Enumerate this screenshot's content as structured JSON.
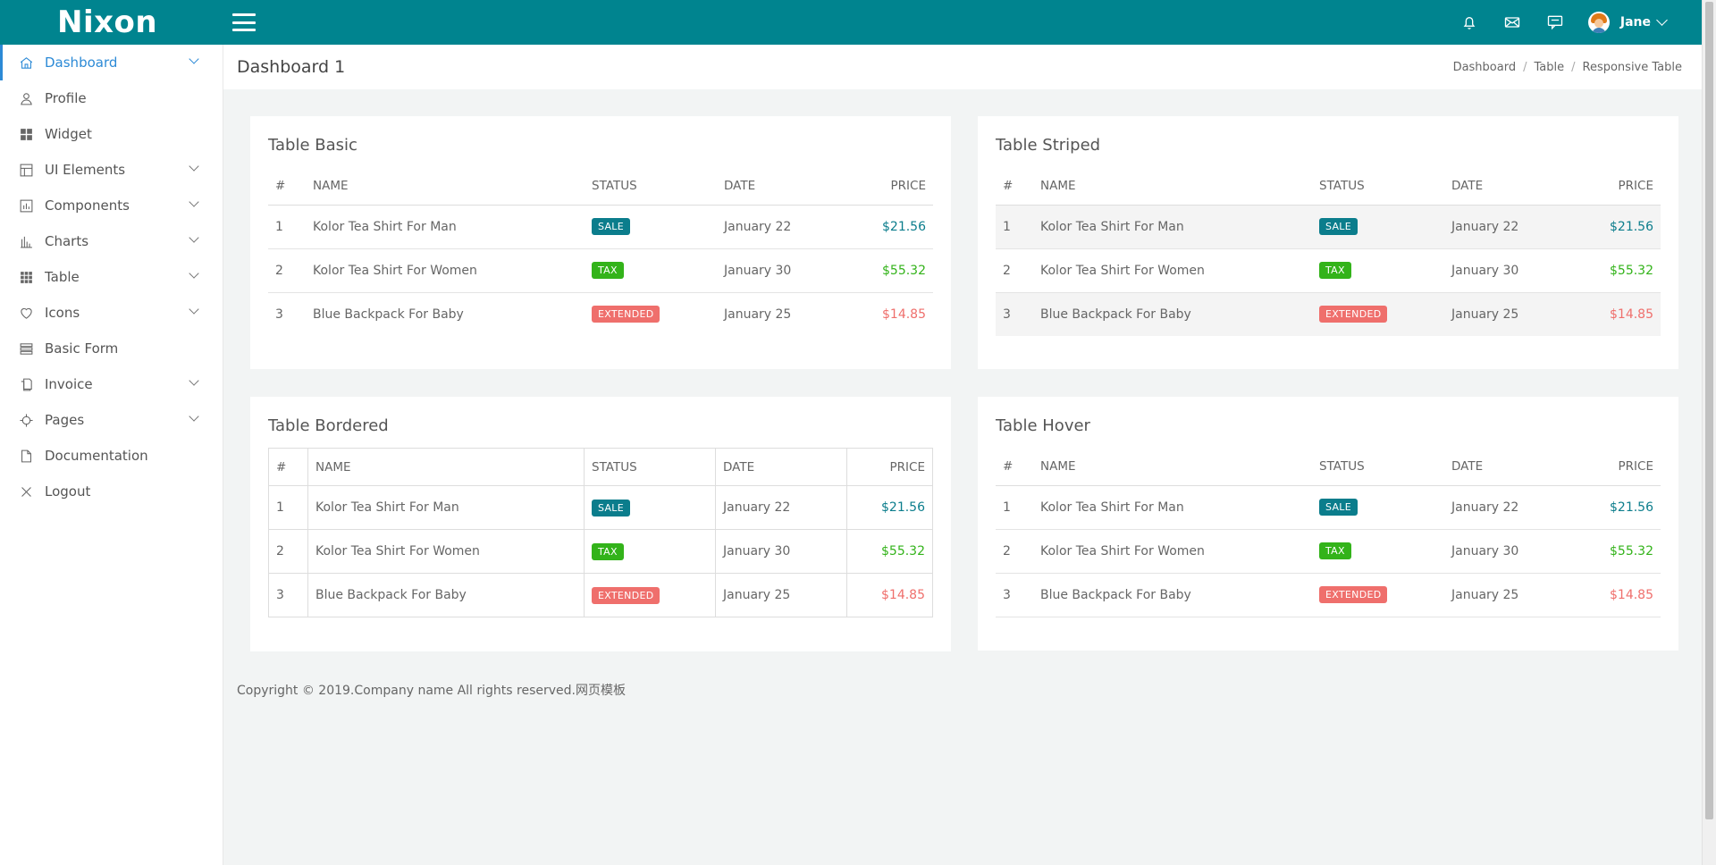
{
  "brand": {
    "name": "Nixon"
  },
  "topbar": {
    "user_name": "Jane",
    "icons": [
      "menu-icon",
      "bell-icon",
      "mail-icon",
      "chat-icon"
    ]
  },
  "sidebar": {
    "items": [
      {
        "label": "Dashboard",
        "icon": "home-icon",
        "expandable": true,
        "active": true
      },
      {
        "label": "Profile",
        "icon": "user-icon",
        "expandable": false
      },
      {
        "label": "Widget",
        "icon": "grid-icon",
        "expandable": false
      },
      {
        "label": "UI Elements",
        "icon": "layout-icon",
        "expandable": true
      },
      {
        "label": "Components",
        "icon": "components-icon",
        "expandable": true
      },
      {
        "label": "Charts",
        "icon": "bar-chart-icon",
        "expandable": true
      },
      {
        "label": "Table",
        "icon": "table-icon",
        "expandable": true
      },
      {
        "label": "Icons",
        "icon": "heart-icon",
        "expandable": true
      },
      {
        "label": "Basic Form",
        "icon": "form-icon",
        "expandable": false
      },
      {
        "label": "Invoice",
        "icon": "invoice-icon",
        "expandable": true
      },
      {
        "label": "Pages",
        "icon": "crosshair-icon",
        "expandable": true
      },
      {
        "label": "Documentation",
        "icon": "document-icon",
        "expandable": false
      },
      {
        "label": "Logout",
        "icon": "close-icon",
        "expandable": false
      }
    ]
  },
  "page": {
    "title": "Dashboard 1",
    "breadcrumb": [
      "Dashboard",
      "Table",
      "Responsive Table"
    ]
  },
  "table_headers": [
    "#",
    "NAME",
    "STATUS",
    "DATE",
    "PRICE"
  ],
  "rows": [
    {
      "num": "1",
      "name": "Kolor Tea Shirt For Man",
      "status": "SALE",
      "status_type": "sale",
      "date": "January 22",
      "price": "$21.56"
    },
    {
      "num": "2",
      "name": "Kolor Tea Shirt For Women",
      "status": "TAX",
      "status_type": "tax",
      "date": "January 30",
      "price": "$55.32"
    },
    {
      "num": "3",
      "name": "Blue Backpack For Baby",
      "status": "EXTENDED",
      "status_type": "extended",
      "date": "January 25",
      "price": "$14.85"
    }
  ],
  "cards": {
    "basic": {
      "title": "Table Basic"
    },
    "striped": {
      "title": "Table Striped"
    },
    "bordered": {
      "title": "Table Bordered"
    },
    "hover": {
      "title": "Table Hover"
    }
  },
  "footer": {
    "text": "Copyright © 2019.Company name All rights reserved.网页模板"
  },
  "colors": {
    "topbar": "#00848f",
    "accent": "#2c8ad6",
    "sale": "#0b7d8c",
    "tax": "#33b31a",
    "extended": "#ef6f6c"
  }
}
